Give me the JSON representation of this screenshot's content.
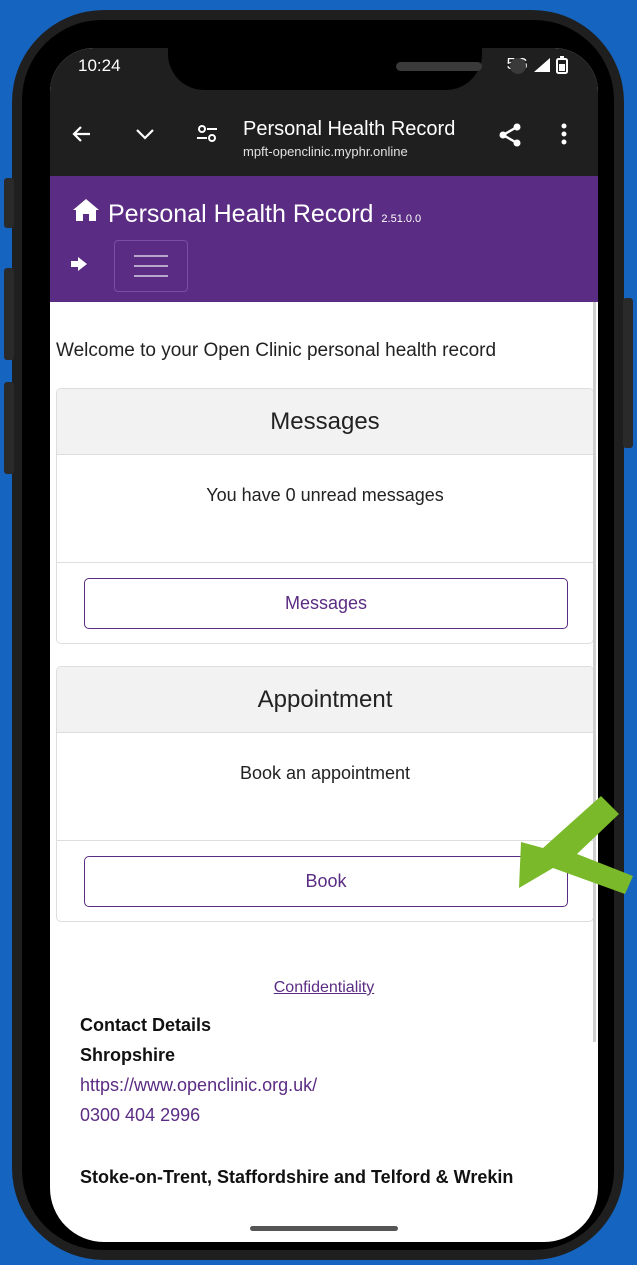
{
  "status": {
    "time": "10:24",
    "network": "5G"
  },
  "browser": {
    "page_title": "Personal Health Record",
    "url": "mpft-openclinic.myphr.online"
  },
  "navbar": {
    "brand": "Personal Health Record",
    "version": "2.51.0.0"
  },
  "main": {
    "welcome": "Welcome to your Open Clinic personal health record",
    "cards": [
      {
        "title": "Messages",
        "body": "You have 0 unread messages",
        "button": "Messages"
      },
      {
        "title": "Appointment",
        "body": "Book an appointment",
        "button": "Book"
      }
    ]
  },
  "footer": {
    "confidentiality": "Confidentiality",
    "contact_heading": "Contact Details",
    "region1": "Shropshire",
    "region1_url": "https://www.openclinic.org.uk/",
    "region1_phone": "0300 404 2996",
    "region2": "Stoke-on-Trent, Staffordshire and Telford & Wrekin"
  },
  "colors": {
    "brand_purple": "#5b2c83",
    "background_blue": "#1565c0",
    "arrow_green": "#7ab929"
  }
}
